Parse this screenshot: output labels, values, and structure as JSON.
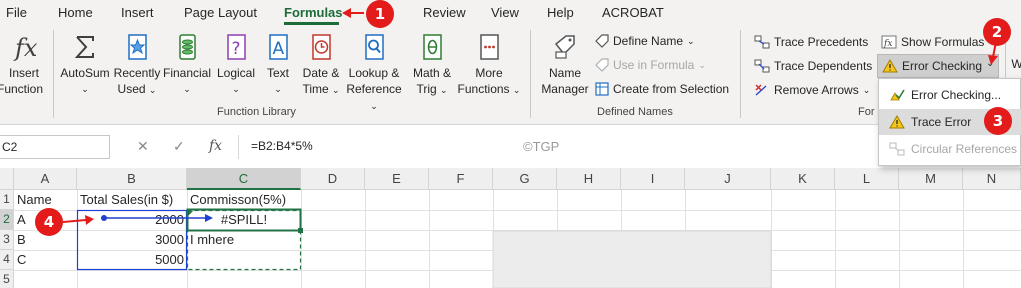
{
  "tabs": [
    "File",
    "Home",
    "Insert",
    "Page Layout",
    "Formulas",
    "Review",
    "View",
    "Help",
    "ACROBAT"
  ],
  "active_tab": "Formulas",
  "ribbon": {
    "insert_function": [
      "Insert",
      "Function"
    ],
    "function_library": {
      "label": "Function Library",
      "buttons": [
        {
          "l1": "AutoSum",
          "l2": ""
        },
        {
          "l1": "Recently",
          "l2": "Used"
        },
        {
          "l1": "Financial",
          "l2": ""
        },
        {
          "l1": "Logical",
          "l2": ""
        },
        {
          "l1": "Text",
          "l2": ""
        },
        {
          "l1": "Date &",
          "l2": "Time"
        },
        {
          "l1": "Lookup &",
          "l2": "Reference"
        },
        {
          "l1": "Math &",
          "l2": "Trig"
        },
        {
          "l1": "More",
          "l2": "Functions"
        }
      ]
    },
    "defined_names": {
      "label": "Defined Names",
      "name_manager": [
        "Name",
        "Manager"
      ],
      "define_name": "Define Name",
      "use_in_formula": "Use in Formula",
      "create_from_selection": "Create from Selection"
    },
    "formula_auditing": {
      "label": "Formula Auditing",
      "label_visible": "For",
      "trace_precedents": "Trace Precedents",
      "trace_dependents": "Trace Dependents",
      "remove_arrows": "Remove Arrows",
      "show_formulas": "Show Formulas",
      "error_checking": "Error Checking",
      "w_partial": "W"
    }
  },
  "dropdown": {
    "items": [
      {
        "label": "Error Checking...",
        "state": "normal"
      },
      {
        "label": "Trace Error",
        "state": "hover"
      },
      {
        "label": "Circular References",
        "state": "disabled"
      }
    ]
  },
  "formula_bar": {
    "name_box": "C2",
    "fx": "fx",
    "formula": "=B2:B4*5%"
  },
  "watermark": "©TGP",
  "sheet": {
    "columns": [
      "A",
      "B",
      "C",
      "D",
      "E",
      "F",
      "G",
      "H",
      "I",
      "J",
      "K",
      "L",
      "M",
      "N"
    ],
    "rows": [
      "1",
      "2",
      "3",
      "4",
      "5"
    ],
    "cells": {
      "A1": "Name",
      "B1": "Total Sales(in $)",
      "C1": "Commisson(5%)",
      "A2": "A",
      "B2": "2000",
      "C2": "#SPILL!",
      "A3": "B",
      "B3": "3000",
      "C3": "I mhere",
      "A4": "C",
      "B4": "5000"
    }
  },
  "callouts": [
    "1",
    "2",
    "3",
    "4"
  ],
  "colors": {
    "excel_green": "#217346",
    "callout_red": "#e31b1b",
    "trace_blue": "#1f3fd6"
  }
}
